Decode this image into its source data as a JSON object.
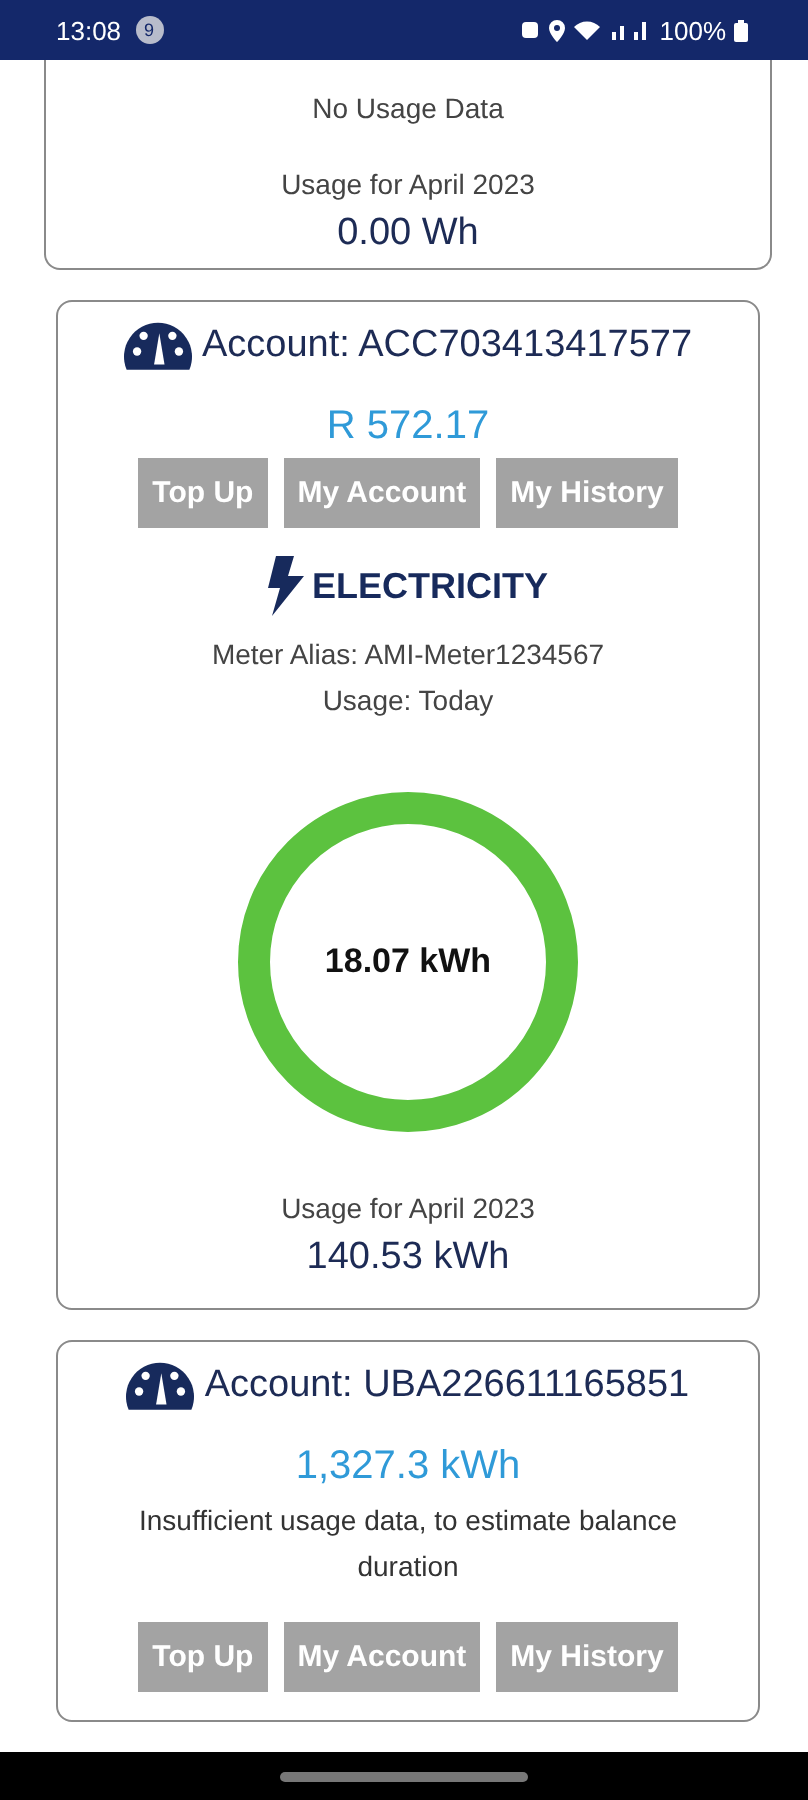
{
  "status_bar": {
    "time": "13:08",
    "notification_count": "9",
    "battery": "100%"
  },
  "cards": [
    {
      "no_usage_text": "No Usage Data",
      "month_label": "Usage for April 2023",
      "month_value": "0.00 Wh"
    },
    {
      "account": "Account: ACC703413417577",
      "balance": "R 572.17",
      "buttons": [
        "Top Up",
        "My Account",
        "My History"
      ],
      "service": "ELECTRICITY",
      "meter_alias": "Meter Alias: AMI-Meter1234567",
      "usage_period": "Usage: Today",
      "gauge_value": "18.07 kWh",
      "month_label": "Usage for April 2023",
      "month_value": "140.53 kWh"
    },
    {
      "account": "Account: UBA226611165851",
      "balance": "1,327.3 kWh",
      "balance_note": "Insufficient usage data, to estimate balance duration",
      "buttons": [
        "Top Up",
        "My Account",
        "My History"
      ]
    }
  ]
}
